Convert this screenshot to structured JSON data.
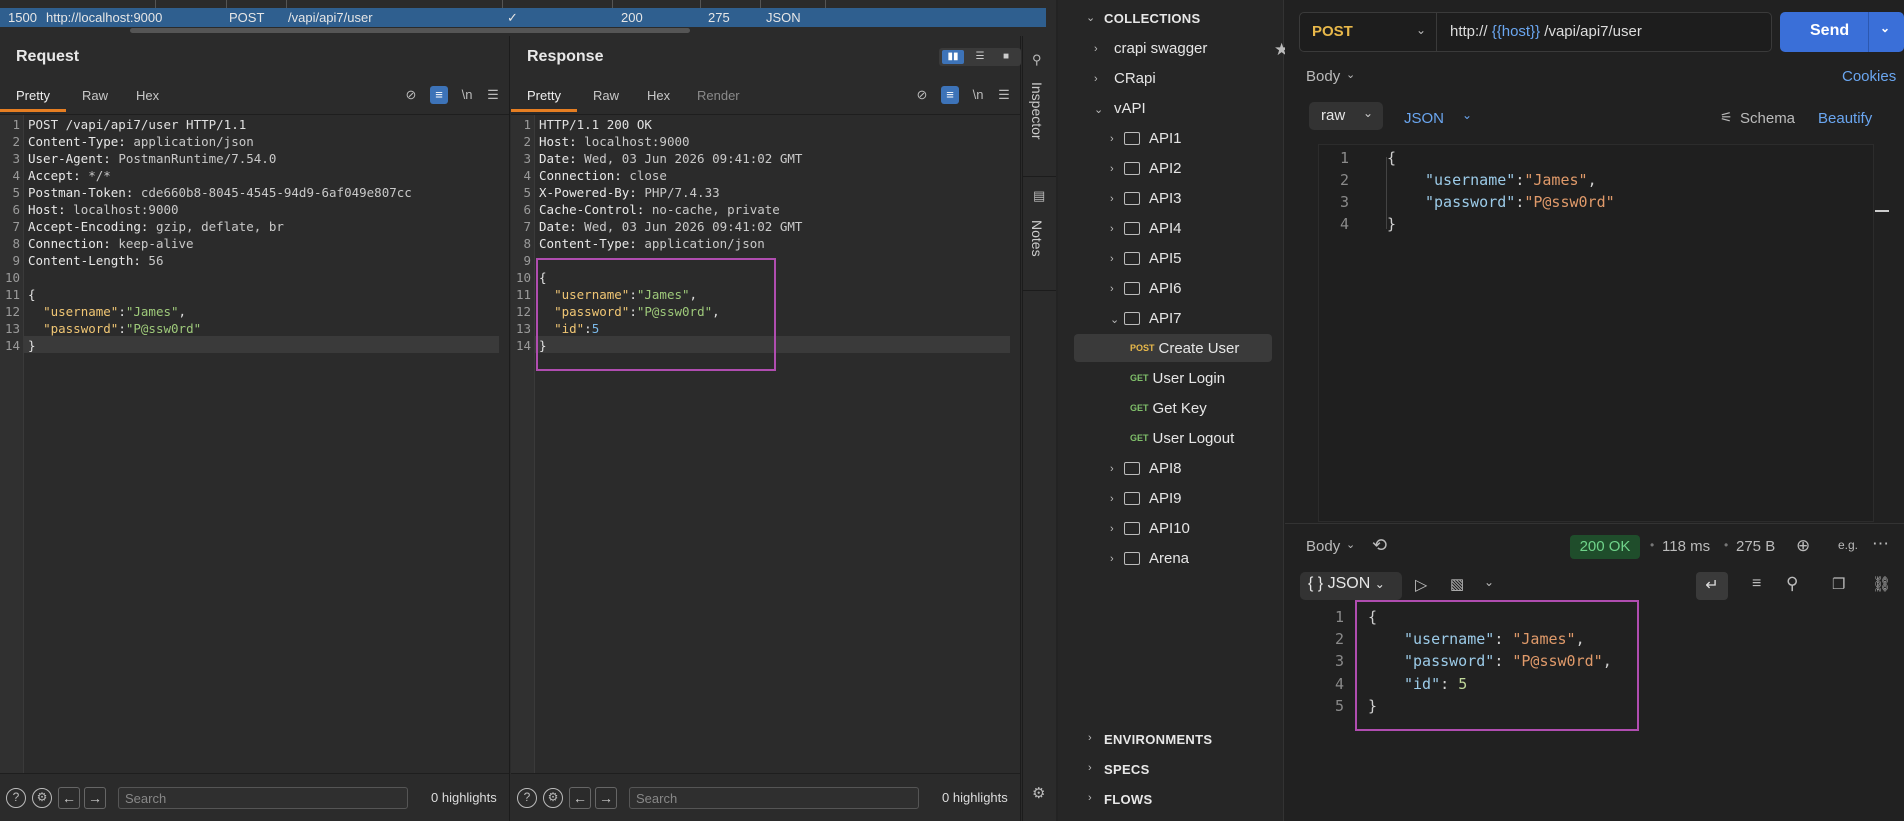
{
  "history_row": {
    "num": "1500",
    "host": "http://localhost:9000",
    "method": "POST",
    "url": "/vapi/api7/user",
    "edited": "✓",
    "status": "200",
    "length": "275",
    "mime": "JSON"
  },
  "request": {
    "title": "Request",
    "tabs": [
      "Pretty",
      "Raw",
      "Hex"
    ],
    "wrap_label": "\\n",
    "lines": [
      "POST /vapi/api7/user HTTP/1.1",
      "Content-Type: application/json",
      "User-Agent: PostmanRuntime/7.54.0",
      "Accept: */*",
      "Postman-Token: cde660b8-8045-4545-94d9-6af049e807cc",
      "Host: localhost:9000",
      "Accept-Encoding: gzip, deflate, br",
      "Connection: keep-alive",
      "Content-Length: 56",
      "",
      "{",
      "  \"username\":\"James\",",
      "  \"password\":\"P@ssw0rd\"",
      "}"
    ],
    "search_placeholder": "Search",
    "highlights": "0 highlights"
  },
  "response": {
    "title": "Response",
    "tabs": [
      "Pretty",
      "Raw",
      "Hex",
      "Render"
    ],
    "wrap_label": "\\n",
    "lines": [
      "HTTP/1.1 200 OK",
      "Host: localhost:9000",
      "Date: Wed, 03 Jun 2026 09:41:02 GMT",
      "Connection: close",
      "X-Powered-By: PHP/7.4.33",
      "Cache-Control: no-cache, private",
      "Date: Wed, 03 Jun 2026 09:41:02 GMT",
      "Content-Type: application/json",
      "",
      "{",
      "  \"username\":\"James\",",
      "  \"password\":\"P@ssw0rd\",",
      "  \"id\":5",
      "}"
    ],
    "search_placeholder": "Search",
    "highlights": "0 highlights"
  },
  "side_tabs": {
    "inspector": "Inspector",
    "notes": "Notes"
  },
  "sidebar": {
    "collections": "COLLECTIONS",
    "items": [
      {
        "label": "crapi swagger",
        "type": "collection"
      },
      {
        "label": "CRapi",
        "type": "collection"
      },
      {
        "label": "vAPI",
        "type": "collection"
      },
      {
        "label": "API1",
        "type": "folder"
      },
      {
        "label": "API2",
        "type": "folder"
      },
      {
        "label": "API3",
        "type": "folder"
      },
      {
        "label": "API4",
        "type": "folder"
      },
      {
        "label": "API5",
        "type": "folder"
      },
      {
        "label": "API6",
        "type": "folder"
      },
      {
        "label": "API7",
        "type": "folder"
      }
    ],
    "requests": [
      {
        "method": "POST",
        "label": "Create User"
      },
      {
        "method": "GET",
        "label": "User Login"
      },
      {
        "method": "GET",
        "label": "Get Key"
      },
      {
        "method": "GET",
        "label": "User Logout"
      }
    ],
    "folders_after": [
      "API8",
      "API9",
      "API10",
      "Arena"
    ],
    "sections": [
      "ENVIRONMENTS",
      "SPECS",
      "FLOWS"
    ]
  },
  "request_bar": {
    "method": "POST",
    "url_prefix": "http://",
    "url_var": "{{host}}",
    "url_path": "/vapi/api7/user",
    "send": "Send"
  },
  "body_tab": {
    "label": "Body",
    "cookies": "Cookies",
    "mode": "raw",
    "format": "JSON",
    "schema": "Schema",
    "beautify": "Beautify"
  },
  "request_body": {
    "line_numbers": [
      "1",
      "2",
      "3",
      "4"
    ],
    "username_key": "\"username\"",
    "username_val": "\"James\"",
    "password_key": "\"password\"",
    "password_val": "\"P@ssw0rd\""
  },
  "response_meta": {
    "label": "Body",
    "status": "200 OK",
    "time": "118 ms",
    "size": "275 B",
    "format": "JSON"
  },
  "response_body": {
    "line_numbers": [
      "1",
      "2",
      "3",
      "4",
      "5"
    ],
    "username_key": "\"username\"",
    "username_val": "\"James\"",
    "password_key": "\"password\"",
    "password_val": "\"P@ssw0rd\"",
    "id_key": "\"id\"",
    "id_val": "5"
  },
  "colors": {
    "accent_blue": "#3a6fd8",
    "burp_selection": "#2f5f8f",
    "highlight_box": "#b04db0",
    "status_ok": "#6fd38a",
    "tab_underline": "#e67e22"
  }
}
